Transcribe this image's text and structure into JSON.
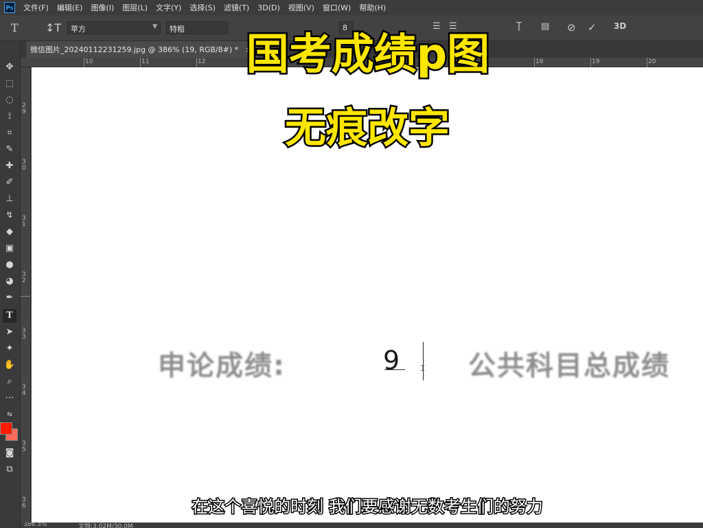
{
  "app": {
    "logo": "Ps"
  },
  "menu": [
    "文件(F)",
    "编辑(E)",
    "图像(I)",
    "图层(L)",
    "文字(Y)",
    "选择(S)",
    "滤镜(T)",
    "3D(D)",
    "视图(V)",
    "窗口(W)",
    "帮助(H)"
  ],
  "options": {
    "font_family": "苹方",
    "font_style": "特粗",
    "size_partial": "8",
    "threed_label": "3D"
  },
  "tab": {
    "title": "微信图片_20240112231259.jpg @ 386% (19, RGB/8#) *",
    "close": "×"
  },
  "ruler_top": [
    "10",
    "11",
    "12",
    "18",
    "19",
    "20"
  ],
  "ruler_left": [
    "2 9",
    "3 0",
    "3 1",
    "3 2",
    "3 3",
    "3 4",
    "3 5",
    "3 6"
  ],
  "canvas": {
    "left_label": "申论成绩:",
    "edit_value": "9",
    "right_label": "公共科目总成绩"
  },
  "overlay": {
    "title": "国考成绩p图",
    "subtitle": "无痕改字"
  },
  "caption": "在这个喜悦的时刻 我们要感谢无数考生们的努力",
  "status": {
    "zoom": "386.3%",
    "doc": "文档:3.02M/30.0M"
  },
  "colors": {
    "foreground": "#ff1a00",
    "background": "#ff6a5a",
    "overlay_text": "#ffe600"
  }
}
